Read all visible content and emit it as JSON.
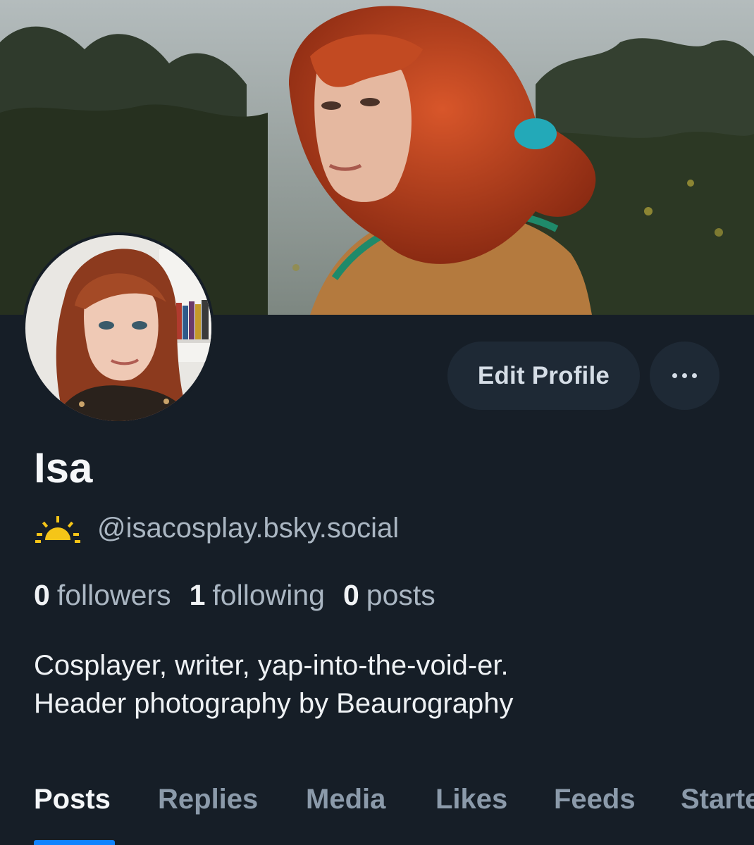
{
  "profile": {
    "display_name": "Isa",
    "handle": "@isacosplay.bsky.social",
    "handle_icon": "sun-icon",
    "bio_lines": [
      "Cosplayer, writer, yap-into-the-void-er.",
      "Header photography by Beaurography"
    ]
  },
  "actions": {
    "edit_profile_label": "Edit Profile",
    "more_icon": "ellipsis-icon"
  },
  "stats": {
    "followers_count": "0",
    "followers_label": "followers",
    "following_count": "1",
    "following_label": "following",
    "posts_count": "0",
    "posts_label": "posts"
  },
  "tabs": [
    "Posts",
    "Replies",
    "Media",
    "Likes",
    "Feeds",
    "Starter Packs"
  ],
  "active_tab": "Posts",
  "colors": {
    "background": "#161e27",
    "accent": "#1083fe",
    "sun_icon": "#f5c518"
  }
}
